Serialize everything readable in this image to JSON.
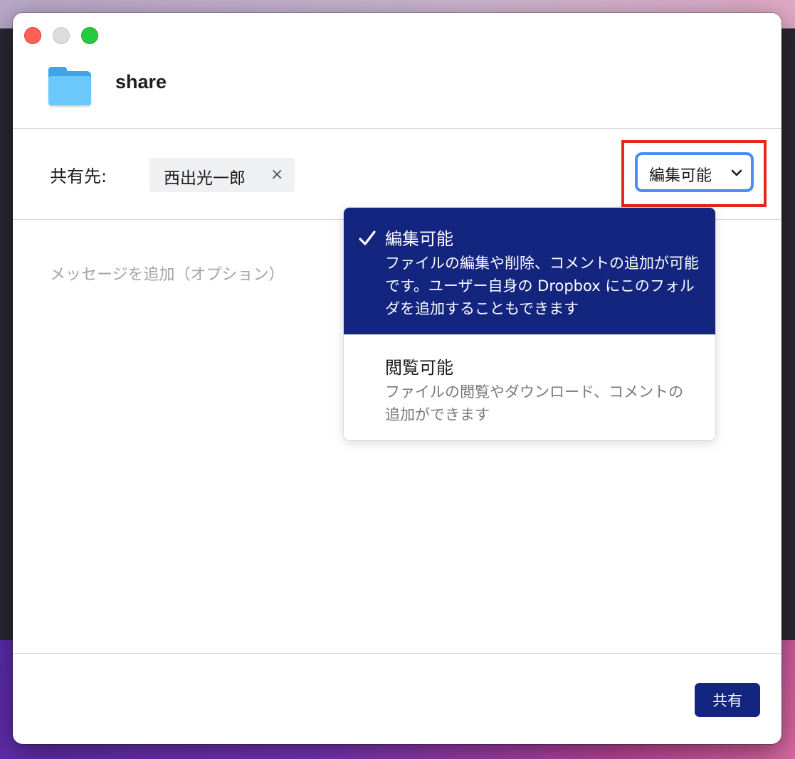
{
  "window": {
    "folder_name": "share"
  },
  "icons": {
    "close": "close-traffic-light",
    "minimize": "minimize-traffic-light",
    "maximize": "maximize-traffic-light",
    "folder": "folder-icon",
    "remove": "close-icon",
    "dropdown": "chevron-down-icon",
    "selected": "checkmark-icon"
  },
  "share": {
    "label": "共有先:",
    "recipient": {
      "name": "西出光一郎",
      "remove_symbol": "×"
    },
    "permission": {
      "selected_label": "編集可能"
    },
    "message_placeholder": "メッセージを追加（オプション）"
  },
  "permission_menu": {
    "options": [
      {
        "title": "編集可能",
        "description": "ファイルの編集や削除、コメントの追加が可能です。ユーザー自身の Dropbox にこのフォルダを追加することもできます",
        "selected": true
      },
      {
        "title": "閲覧可能",
        "description": "ファイルの閲覧やダウンロード、コメントの追加ができます",
        "selected": false
      }
    ]
  },
  "footer": {
    "share_button_label": "共有"
  },
  "colors": {
    "accent": "#142580",
    "focus_ring": "#4a8df8",
    "annotation_box": "#e5281e",
    "chip_background": "#eef0f2"
  }
}
